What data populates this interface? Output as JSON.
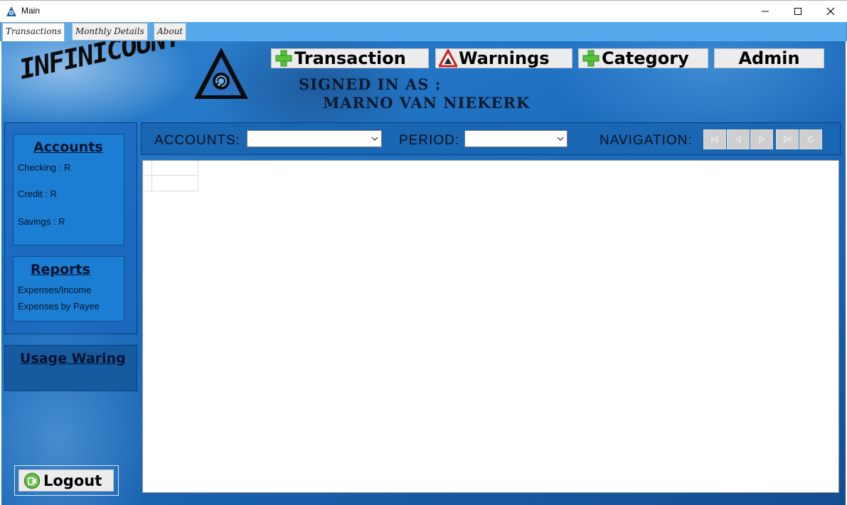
{
  "window": {
    "title": "Main",
    "app_icon": "triangle-logo-icon",
    "controls": [
      "minimize-icon",
      "maximize-icon",
      "close-icon"
    ]
  },
  "tabs": [
    {
      "label": "Transactions",
      "active": true
    },
    {
      "label": "Monthly Details",
      "active": false
    },
    {
      "label": "About",
      "active": false
    }
  ],
  "header": {
    "logo_text": "INFINICOUNT",
    "buttons": {
      "transaction": {
        "label": "Transaction",
        "icon": "plus-icon"
      },
      "warnings": {
        "label": "Warnings",
        "icon": "warning-triangle-icon"
      },
      "category": {
        "label": "Category",
        "icon": "plus-icon"
      },
      "admin": {
        "label": "Admin"
      }
    },
    "signed_in_label": "SIGNED IN AS :",
    "signed_in_name": "MARNO VAN NIEKERK"
  },
  "sidebar": {
    "accounts": {
      "heading": "Accounts",
      "items": [
        "Checking : R",
        "Credit : R",
        "Savings : R"
      ]
    },
    "reports": {
      "heading": "Reports",
      "items": [
        "Expenses/Income",
        "Expenses by Payee"
      ]
    },
    "usage": {
      "heading": "Usage Waring"
    },
    "logout": {
      "label": "Logout",
      "icon": "logout-icon"
    }
  },
  "filters": {
    "accounts_label": "ACCOUNTS:",
    "accounts_value": "",
    "period_label": "PERIOD:",
    "period_value": "",
    "navigation_label": "NAVIGATION:",
    "nav_buttons": [
      "first-record-icon",
      "previous-record-icon",
      "next-record-icon",
      "last-record-icon",
      "refresh-icon"
    ]
  },
  "colors": {
    "tabstrip": "#55aaee",
    "panel": "#1e6fc0",
    "sidebar_box": "#1b7ed2",
    "plus_green": "#55c43a",
    "warning_red": "#d41c1c"
  }
}
